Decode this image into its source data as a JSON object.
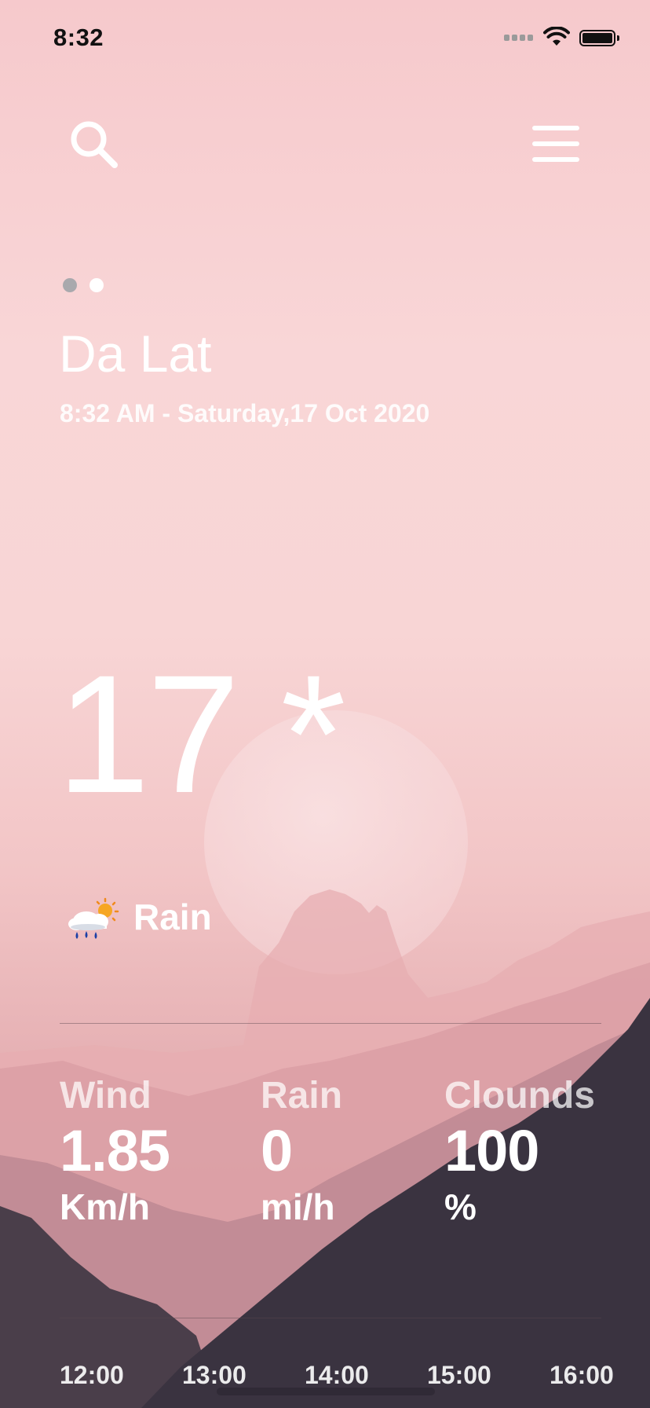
{
  "status_bar": {
    "time": "8:32"
  },
  "header": {
    "city": "Da Lat",
    "datetime": "8:32 AM - Saturday,17 Oct 2020"
  },
  "pagination": {
    "count": 2,
    "active_index": 1
  },
  "current": {
    "temperature": "17 *",
    "condition": "Rain",
    "condition_icon": "rain-sun-icon"
  },
  "stats": [
    {
      "label": "Wind",
      "value": "1.85",
      "unit": "Km/h"
    },
    {
      "label": "Rain",
      "value": "0",
      "unit": "mi/h"
    },
    {
      "label": "Clounds",
      "value": "100",
      "unit": "%"
    }
  ],
  "hourly": [
    "12:00",
    "13:00",
    "14:00",
    "15:00",
    "16:00"
  ],
  "colors": {
    "text": "#ffffff",
    "sky_top": "#f6c9cc",
    "mountain_dark": "#3a3340",
    "dot_inactive": "#a9a9ad"
  }
}
